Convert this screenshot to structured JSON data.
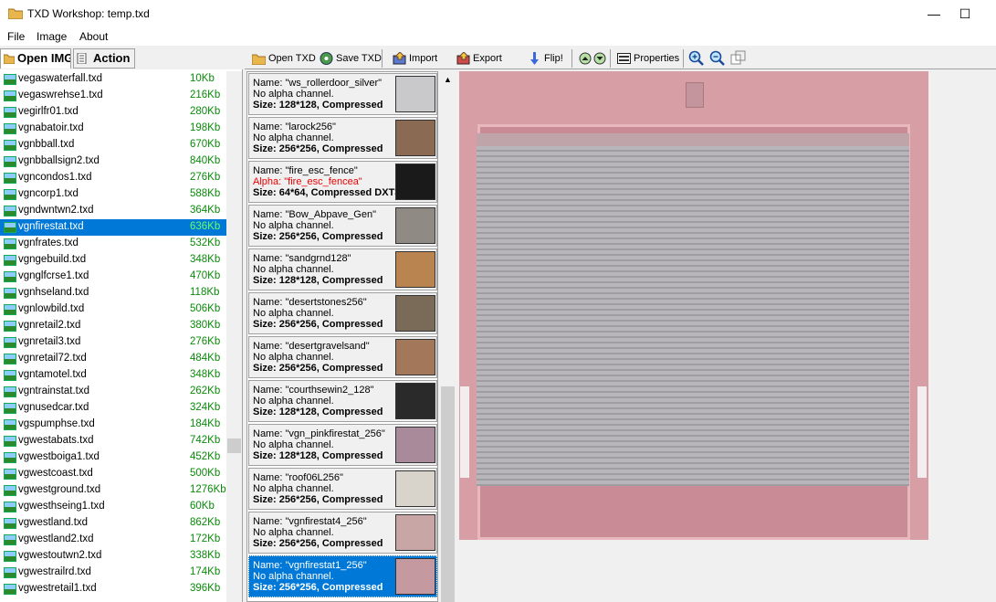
{
  "window": {
    "title": "TXD Workshop: temp.txd",
    "minimize": "—",
    "maximize": "☐"
  },
  "menu": [
    "File",
    "Image",
    "About"
  ],
  "left_tabs": [
    {
      "label": "Open IMG",
      "icon": "folder-icon"
    },
    {
      "label": "Action",
      "icon": "document-icon"
    }
  ],
  "files": [
    {
      "name": "vegaswaterfall.txd",
      "size": "10Kb"
    },
    {
      "name": "vegaswrehse1.txd",
      "size": "216Kb"
    },
    {
      "name": "vegirlfr01.txd",
      "size": "280Kb"
    },
    {
      "name": "vgnabatoir.txd",
      "size": "198Kb"
    },
    {
      "name": "vgnbball.txd",
      "size": "670Kb"
    },
    {
      "name": "vgnbballsign2.txd",
      "size": "840Kb"
    },
    {
      "name": "vgncondos1.txd",
      "size": "276Kb"
    },
    {
      "name": "vgncorp1.txd",
      "size": "588Kb"
    },
    {
      "name": "vgndwntwn2.txd",
      "size": "364Kb"
    },
    {
      "name": "vgnfirestat.txd",
      "size": "636Kb",
      "selected": true
    },
    {
      "name": "vgnfrates.txd",
      "size": "532Kb"
    },
    {
      "name": "vgngebuild.txd",
      "size": "348Kb"
    },
    {
      "name": "vgnglfcrse1.txd",
      "size": "470Kb"
    },
    {
      "name": "vgnhseland.txd",
      "size": "118Kb"
    },
    {
      "name": "vgnlowbild.txd",
      "size": "506Kb"
    },
    {
      "name": "vgnretail2.txd",
      "size": "380Kb"
    },
    {
      "name": "vgnretail3.txd",
      "size": "276Kb"
    },
    {
      "name": "vgnretail72.txd",
      "size": "484Kb"
    },
    {
      "name": "vgntamotel.txd",
      "size": "348Kb"
    },
    {
      "name": "vgntrainstat.txd",
      "size": "262Kb"
    },
    {
      "name": "vgnusedcar.txd",
      "size": "324Kb"
    },
    {
      "name": "vgspumphse.txd",
      "size": "184Kb"
    },
    {
      "name": "vgwestabats.txd",
      "size": "742Kb"
    },
    {
      "name": "vgwestboiga1.txd",
      "size": "452Kb"
    },
    {
      "name": "vgwestcoast.txd",
      "size": "500Kb"
    },
    {
      "name": "vgwestground.txd",
      "size": "1276Kb"
    },
    {
      "name": "vgwesthseing1.txd",
      "size": "60Kb"
    },
    {
      "name": "vgwestland.txd",
      "size": "862Kb"
    },
    {
      "name": "vgwestland2.txd",
      "size": "172Kb"
    },
    {
      "name": "vgwestoutwn2.txd",
      "size": "338Kb"
    },
    {
      "name": "vgwestrailrd.txd",
      "size": "174Kb"
    },
    {
      "name": "vgwestretail1.txd",
      "size": "396Kb"
    }
  ],
  "toolbar": {
    "open_txd": "Open TXD",
    "save_txd": "Save TXD",
    "import": "Import",
    "export": "Export",
    "flip": "Flip!",
    "properties": "Properties"
  },
  "textures": [
    {
      "name": "Name: \"ws_rollerdoor_silver\"",
      "alpha": "No alpha channel.",
      "has_alpha": false,
      "size": "Size: 128*128, Compressed",
      "thumb": "#c9c9cc"
    },
    {
      "name": "Name: \"larock256\"",
      "alpha": "No alpha channel.",
      "has_alpha": false,
      "size": "Size: 256*256, Compressed",
      "thumb": "#8a6a52"
    },
    {
      "name": "Name: \"fire_esc_fence\"",
      "alpha": "Alpha: \"fire_esc_fencea\"",
      "has_alpha": true,
      "size": "Size: 64*64, Compressed DXT3",
      "thumb": "#1a1a1a"
    },
    {
      "name": "Name: \"Bow_Abpave_Gen\"",
      "alpha": "No alpha channel.",
      "has_alpha": false,
      "size": "Size: 256*256, Compressed",
      "thumb": "#8f8a84"
    },
    {
      "name": "Name: \"sandgrnd128\"",
      "alpha": "No alpha channel.",
      "has_alpha": false,
      "size": "Size: 128*128, Compressed",
      "thumb": "#b9844f"
    },
    {
      "name": "Name: \"desertstones256\"",
      "alpha": "No alpha channel.",
      "has_alpha": false,
      "size": "Size: 256*256, Compressed",
      "thumb": "#7a6a58"
    },
    {
      "name": "Name: \"desertgravelsand\"",
      "alpha": "No alpha channel.",
      "has_alpha": false,
      "size": "Size: 256*256, Compressed",
      "thumb": "#a3785a"
    },
    {
      "name": "Name: \"courthsewin2_128\"",
      "alpha": "No alpha channel.",
      "has_alpha": false,
      "size": "Size: 128*128, Compressed",
      "thumb": "#2a2a2a"
    },
    {
      "name": "Name: \"vgn_pinkfirestat_256\"",
      "alpha": "No alpha channel.",
      "has_alpha": false,
      "size": "Size: 128*128, Compressed",
      "thumb": "#a98a9a"
    },
    {
      "name": "Name: \"roof06L256\"",
      "alpha": "No alpha channel.",
      "has_alpha": false,
      "size": "Size: 256*256, Compressed",
      "thumb": "#d8d4cc"
    },
    {
      "name": "Name: \"vgnfirestat4_256\"",
      "alpha": "No alpha channel.",
      "has_alpha": false,
      "size": "Size: 256*256, Compressed",
      "thumb": "#c9a6a6"
    },
    {
      "name": "Name: \"vgnfirestat1_256\"",
      "alpha": "No alpha channel.",
      "has_alpha": false,
      "size": "Size: 256*256, Compressed",
      "thumb": "#c49aa0",
      "selected": true
    }
  ],
  "colors": {
    "selection": "#0078d7",
    "size_text": "#0a8a0a",
    "alpha_text": "#ee0000"
  }
}
